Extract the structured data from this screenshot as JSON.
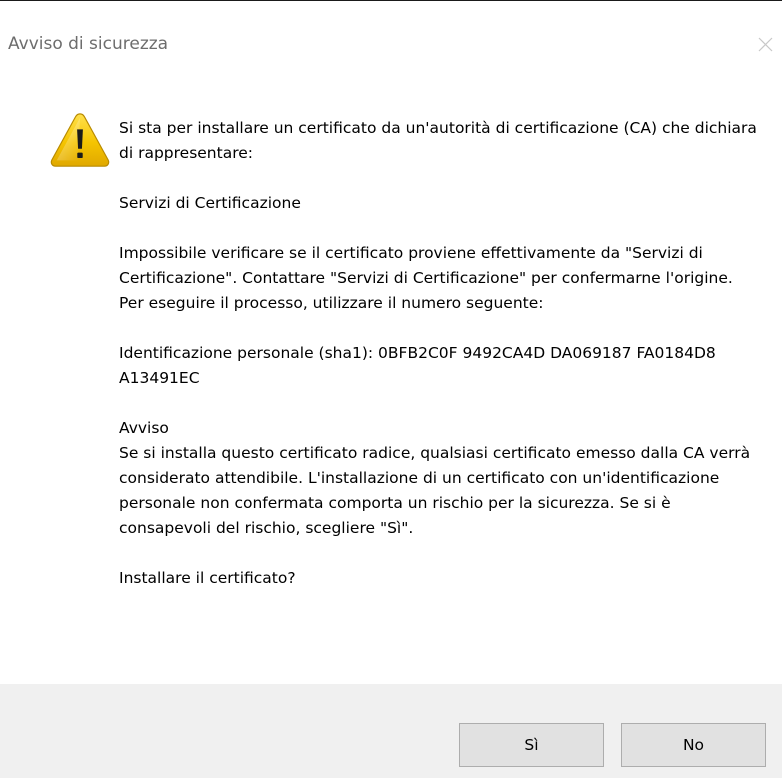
{
  "window": {
    "title": "Avviso di sicurezza",
    "close_icon": "close-icon"
  },
  "icon": {
    "name": "warning-icon",
    "color": "#f5c400"
  },
  "message": {
    "intro": "Si sta per installare un certificato da un'autorità di certificazione (CA) che dichiara di rappresentare:",
    "issuer": "Servizi di Certificazione",
    "verify": "Impossibile verificare se il certificato proviene effettivamente da \"Servizi di Certificazione\". Contattare \"Servizi di Certificazione\" per confermarne l'origine. Per eseguire il processo, utilizzare il numero seguente:",
    "thumbprint": "Identificazione personale (sha1): 0BFB2C0F 9492CA4D DA069187 FA0184D8 A13491EC",
    "warning_heading": "Avviso",
    "warning_text": "Se si installa questo certificato radice, qualsiasi certificato emesso dalla CA verrà considerato attendibile. L'installazione di un certificato con un'identificazione personale non confermata comporta un rischio per la sicurezza. Se si è consapevoli del rischio, scegliere \"Sì\".",
    "question": "Installare il certificato?"
  },
  "buttons": {
    "yes_label": "Sì",
    "no_label": "No"
  },
  "colors": {
    "footer_bg": "#f0f0f0",
    "button_bg": "#e1e1e1",
    "button_border": "#adadad",
    "title_text": "#6d6d6d"
  }
}
